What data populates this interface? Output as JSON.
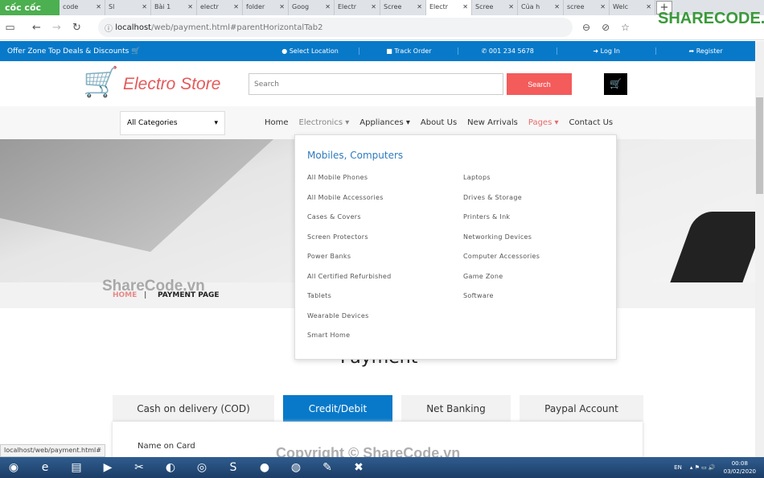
{
  "browser": {
    "brand": "cốc cốc",
    "tabs": [
      "code",
      "Sl",
      "Bài 1",
      "electr",
      "folder",
      "Goog",
      "Electr",
      "Scree",
      "Electr",
      "Scree",
      "Của h",
      "scree",
      "Welc"
    ],
    "active_tab": 8,
    "url_host": "localhost",
    "url_path": "/web/payment.html#parentHorizontalTab2",
    "status_url": "localhost/web/payment.html#"
  },
  "topbar": {
    "offer": "Offer Zone Top Deals & Discounts",
    "items": [
      "Select Location",
      "Track Order",
      "001 234 5678",
      "Log In",
      "Register"
    ]
  },
  "header": {
    "logo": "Electro Store",
    "search_placeholder": "Search",
    "search_button": "Search"
  },
  "nav": {
    "category": "All Categories",
    "items": [
      "Home",
      "Electronics",
      "Appliances",
      "About Us",
      "New Arrivals",
      "Pages",
      "Contact Us"
    ]
  },
  "dropdown": {
    "title": "Mobiles, Computers",
    "col1": [
      "All Mobile Phones",
      "All Mobile Accessories",
      "Cases & Covers",
      "Screen Protectors",
      "Power Banks",
      "All Certified Refurbished",
      "Tablets",
      "Wearable Devices",
      "Smart Home"
    ],
    "col2": [
      "Laptops",
      "Drives & Storage",
      "Printers & Ink",
      "Networking Devices",
      "Computer Accessories",
      "Game Zone",
      "Software"
    ]
  },
  "breadcrumb": {
    "home": "HOME",
    "sep": "|",
    "current": "PAYMENT PAGE"
  },
  "payment": {
    "title": "Payment",
    "tabs": [
      "Cash on delivery (COD)",
      "Credit/Debit",
      "Net Banking",
      "Paypal Account"
    ],
    "active": 1,
    "field_label": "Name on Card"
  },
  "taskbar": {
    "lang": "EN",
    "time": "00:08",
    "date": "03/02/2020"
  },
  "watermarks": [
    "ShareCode.vn",
    "Copyright © ShareCode.vn",
    "SHARECODE.vn"
  ],
  "colors": {
    "accent": "#0879c9",
    "search": "#f45b5b",
    "logo": "#e55a5a"
  }
}
